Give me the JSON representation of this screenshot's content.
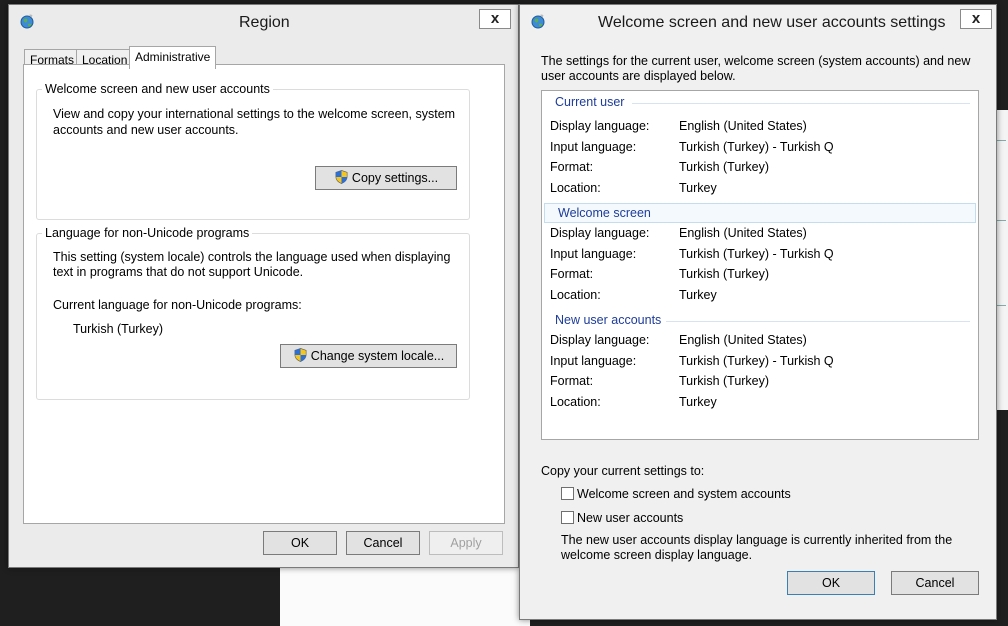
{
  "region": {
    "title": "Region",
    "close": "x",
    "tabs": [
      "Formats",
      "Location",
      "Administrative"
    ],
    "welcome_group": {
      "title": "Welcome screen and new user accounts",
      "desc1": "View and copy your international settings to the welcome screen, system",
      "desc2": "accounts and new user accounts.",
      "button": "Copy settings..."
    },
    "unicode_group": {
      "title": "Language for non-Unicode programs",
      "desc1": "This setting (system locale) controls the language used when displaying",
      "desc2": "text in programs that do not support Unicode.",
      "current_label": "Current language for non-Unicode programs:",
      "current_value": "Turkish (Turkey)",
      "button": "Change system locale..."
    },
    "buttons": {
      "ok": "OK",
      "cancel": "Cancel",
      "apply": "Apply"
    }
  },
  "welcome": {
    "title": "Welcome screen and new user accounts settings",
    "close": "x",
    "intro1": "The settings for the current user, welcome screen (system accounts) and new",
    "intro2": "user accounts are displayed below.",
    "labels": {
      "display": "Display language:",
      "input": "Input language:",
      "format": "Format:",
      "location": "Location:"
    },
    "sections": [
      {
        "title": "Current user",
        "display": "English (United States)",
        "input": "Turkish (Turkey) - Turkish Q",
        "format": "Turkish (Turkey)",
        "location": "Turkey"
      },
      {
        "title": "Welcome screen",
        "display": "English (United States)",
        "input": "Turkish (Turkey) - Turkish Q",
        "format": "Turkish (Turkey)",
        "location": "Turkey"
      },
      {
        "title": "New user accounts",
        "display": "English (United States)",
        "input": "Turkish (Turkey) - Turkish Q",
        "format": "Turkish (Turkey)",
        "location": "Turkey"
      }
    ],
    "copy_label": "Copy your current settings to:",
    "checkbox1": "Welcome screen and system accounts",
    "checkbox2": "New user accounts",
    "note1": "The new user accounts display language is currently inherited from the",
    "note2": "welcome screen display language.",
    "buttons": {
      "ok": "OK",
      "cancel": "Cancel"
    }
  }
}
